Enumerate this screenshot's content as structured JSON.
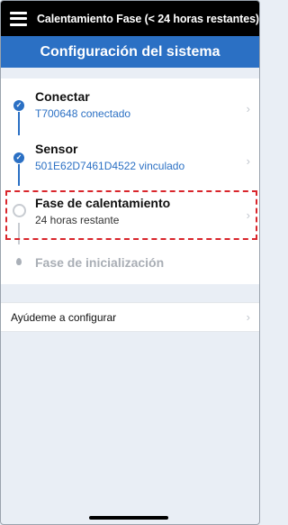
{
  "header": {
    "title": "Calentamiento Fase (< 24 horas restantes)",
    "subtitle": "Configuración del sistema"
  },
  "steps": [
    {
      "title": "Conectar",
      "subtitle": "T700648 conectado",
      "status": "complete"
    },
    {
      "title": "Sensor",
      "subtitle": "501E62D7461D4522 vinculado",
      "status": "complete"
    },
    {
      "title": "Fase de calentamiento",
      "subtitle": "24 horas restante",
      "status": "current"
    },
    {
      "title": "Fase de inicialización",
      "subtitle": "",
      "status": "pending"
    }
  ],
  "help": {
    "label": "Ayúdeme a configurar"
  },
  "icons": {
    "menu": "menu-icon",
    "check": "check-icon",
    "chevron": "chevron-right-icon",
    "pending": "drop-icon"
  },
  "colors": {
    "accent": "#2b70c4",
    "topbar": "#000000",
    "highlight": "#d9252b",
    "background": "#e9eef5"
  }
}
